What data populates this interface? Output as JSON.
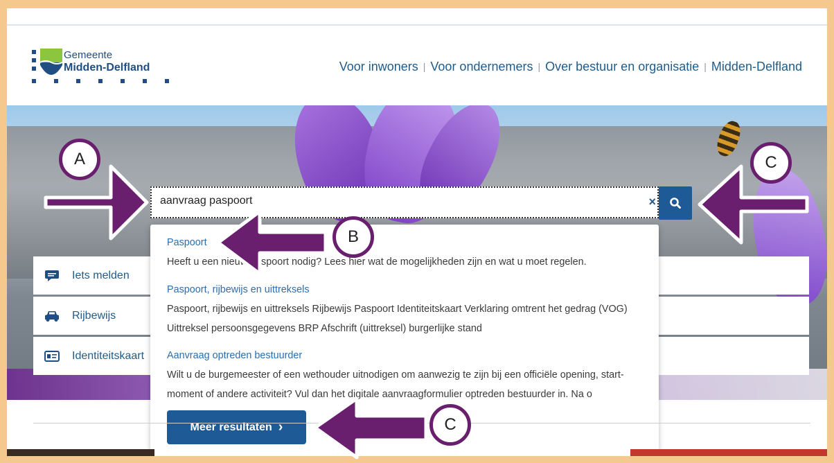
{
  "header": {
    "logo_line1": "Gemeente",
    "logo_line2": "Midden-Delfland",
    "nav": [
      "Voor inwoners",
      "Voor ondernemers",
      "Over bestuur en organisatie",
      "Midden-Delfland"
    ],
    "nav_separator": "|"
  },
  "search": {
    "value": "aanvraag paspoort",
    "clear_icon": "×",
    "button_icon": "search-icon"
  },
  "results": [
    {
      "title": "Paspoort",
      "text": "Heeft u een nieuw paspoort nodig? Lees hier wat de mogelijkheden zijn en wat u moet regelen."
    },
    {
      "title": "Paspoort, rijbewijs en uittreksels",
      "text": "Paspoort, rijbewijs en uittreksels Rijbewijs Paspoort Identiteitskaart Verklaring omtrent het gedrag (VOG) Uittreksel persoonsgegevens BRP Afschrift (uittreksel) burgerlijke stand"
    },
    {
      "title": "Aanvraag optreden bestuurder",
      "text": "Wilt u de burgemeester of een wethouder uitnodigen om aanwezig te zijn bij een officiële opening, start-moment of andere activiteit? Vul dan het digitale aanvraagformulier optreden bestuurder  in. Na o"
    }
  ],
  "more_button": "Meer resultaten",
  "more_chevron": "›",
  "quick_links": [
    {
      "label": "Iets melden",
      "icon": "message-icon"
    },
    {
      "label": "Rijbewijs",
      "icon": "car-icon"
    },
    {
      "label": "Identiteitskaart",
      "icon": "id-card-icon"
    }
  ],
  "annotations": {
    "a": "A",
    "b": "B",
    "c1": "C",
    "c2": "C",
    "color": "#6a1e6e"
  },
  "colors": {
    "brand_blue": "#1d5a96",
    "link_blue": "#2a6eb0",
    "frame": "#f5c88e"
  }
}
